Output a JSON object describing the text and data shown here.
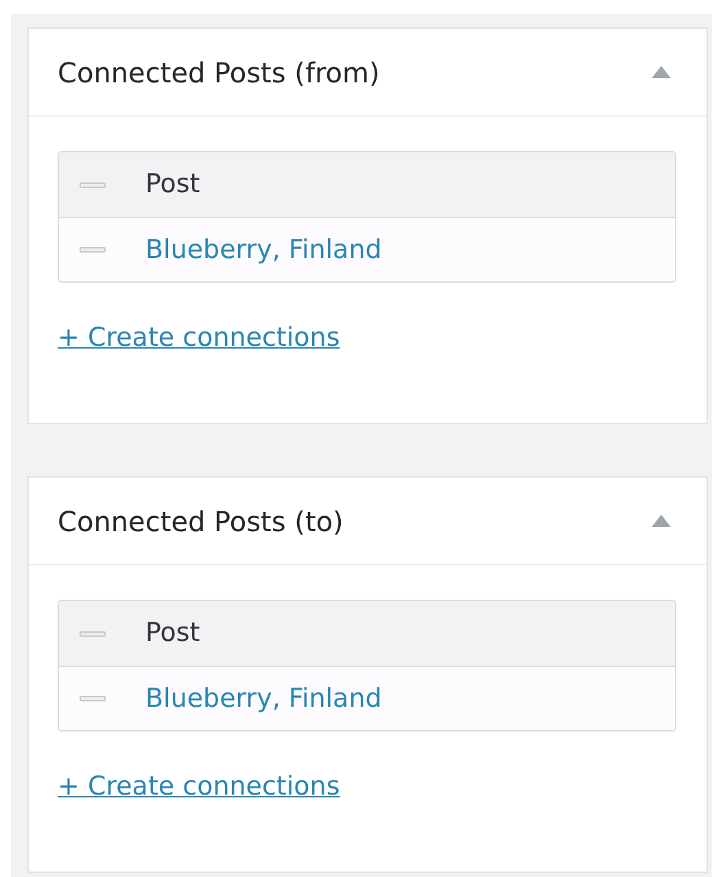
{
  "panels": [
    {
      "title": "Connected Posts (from)",
      "expanded": true,
      "column": "Post",
      "rows": [
        "Blueberry, Finland"
      ],
      "action": "+ Create connections"
    },
    {
      "title": "Connected Posts (to)",
      "expanded": true,
      "column": "Post",
      "rows": [
        "Blueberry, Finland"
      ],
      "action": "+ Create connections"
    }
  ]
}
